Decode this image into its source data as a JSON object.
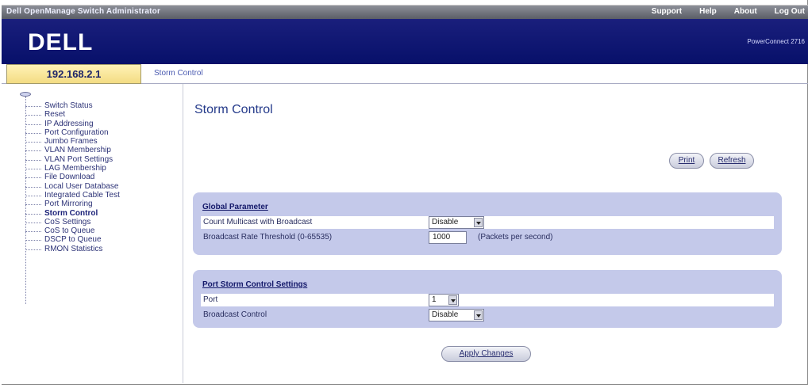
{
  "header": {
    "app_title": "Dell OpenManage Switch Administrator",
    "links": [
      "Support",
      "Help",
      "About",
      "Log Out"
    ],
    "logo": "DELL",
    "product": "PowerConnect 2716"
  },
  "address": {
    "ip": "192.168.2.1",
    "breadcrumb": "Storm Control"
  },
  "sidebar": {
    "items": [
      {
        "label": "Switch Status"
      },
      {
        "label": "Reset"
      },
      {
        "label": "IP Addressing"
      },
      {
        "label": "Port Configuration"
      },
      {
        "label": "Jumbo Frames"
      },
      {
        "label": "VLAN Membership"
      },
      {
        "label": "VLAN Port Settings"
      },
      {
        "label": "LAG Membership"
      },
      {
        "label": "File Download"
      },
      {
        "label": "Local User Database"
      },
      {
        "label": "Integrated Cable Test"
      },
      {
        "label": "Port Mirroring"
      },
      {
        "label": "Storm Control"
      },
      {
        "label": "CoS Settings"
      },
      {
        "label": "CoS to Queue"
      },
      {
        "label": "DSCP to Queue"
      },
      {
        "label": "RMON Statistics"
      }
    ],
    "active_index": 12
  },
  "main": {
    "title": "Storm Control",
    "print_label": "Print",
    "refresh_label": "Refresh",
    "apply_label": "Apply Changes",
    "global": {
      "title": "Global Parameter",
      "count_multicast_label": "Count Multicast with Broadcast",
      "count_multicast_value": "Disable",
      "threshold_label": "Broadcast Rate Threshold (0-65535)",
      "threshold_value": "1000",
      "threshold_hint": "(Packets per second)"
    },
    "port": {
      "title": "Port Storm Control Settings",
      "port_label": "Port",
      "port_value": "1",
      "broadcast_label": "Broadcast Control",
      "broadcast_value": "Disable"
    }
  }
}
